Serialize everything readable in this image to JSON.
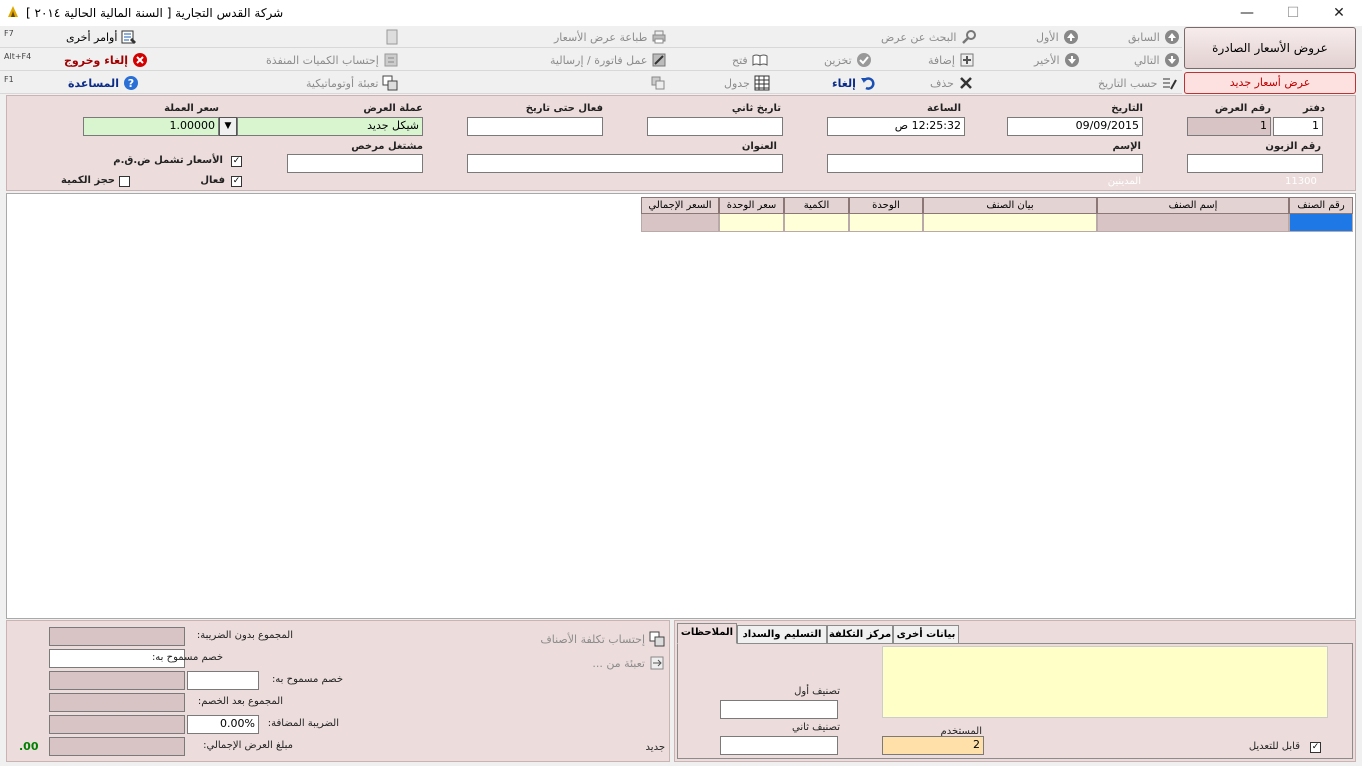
{
  "window": {
    "title": "شركة القدس التجارية  [ السنة المالية الحالية ٢٠١٤ ]",
    "minimize": "—",
    "maximize": "☐",
    "close": "✕"
  },
  "toolbar": {
    "row1": {
      "previous": "السابق",
      "first": "الأول",
      "search": "البحث عن عرض",
      "print": "طباعة عرض الأسعار",
      "other": "أوامر أخرى",
      "fkey": "F7"
    },
    "row2": {
      "next": "التالي",
      "last": "الأخير",
      "add": "إضافة",
      "save": "تخزين",
      "open": "فتح",
      "invoice": "عمل فاتورة / إرسالية",
      "calc_qty": "إحتساب الكميات المنفذة",
      "cancel_exit": "إلغاء وخروج",
      "fkey": "Alt+F4"
    },
    "row3": {
      "by_date": "حسب التاريخ",
      "delete": "حذف",
      "cancel": "إلغاء",
      "table": "جدول",
      "autofill": "تعبئة أوتوماتيكية",
      "help": "المساعدة",
      "fkey": "F1"
    },
    "issued_quotes_button": "عروض الأسعار الصادرة",
    "new_quote_button": "عرض أسعار جديد"
  },
  "header": {
    "book_label": "دفتر",
    "book_value": "1",
    "quote_no_label": "رقم العرض",
    "quote_no_value": "1",
    "date_label": "التاريخ",
    "date_value": "09/09/2015",
    "time_label": "الساعة",
    "time_value": "12:25:32 ص",
    "second_date_label": "تاريخ ثاني",
    "second_date_value": "",
    "valid_until_label": "فعال حتى تاريخ",
    "valid_until_value": "",
    "currency_label": "عملة العرض",
    "currency_value": "شيكل جديد",
    "rate_label": "سعر العملة",
    "rate_value": "1.00000",
    "customer_no_label": "رقم الزبون",
    "customer_no_value": "",
    "name_label": "الإسم",
    "name_value": "",
    "address_label": "العنوان",
    "address_value": "",
    "licensed_label": "مشتغل مرخص",
    "licensed_value": "",
    "vat_incl_label": "الأسعار تشمل ض.ق.م",
    "vat_incl_checked": "✓",
    "active_label": "فعال",
    "active_checked": "✓",
    "reserve_label": "حجز الكمية",
    "reserve_checked": "",
    "account_no": "11300",
    "account_name": "المدينين"
  },
  "grid": {
    "columns": [
      "رقم الصنف",
      "إسم الصنف",
      "بيان الصنف",
      "الوحدة",
      "الكمية",
      "سعر الوحدة",
      "السعر الإجمالي"
    ]
  },
  "totals": {
    "calc_cost": "إحتساب تكلفة الأصناف",
    "fill_from": "تعبئة من ...",
    "subtotal_label": "المجموع بدون الضريبة:",
    "subtotal_value": "",
    "discount1_label": "خصم مسموح به:",
    "discount1_value": "",
    "discount2_label": "خصم مسموح به:",
    "discount2_pct": "",
    "discount2_value": "",
    "after_discount_label": "المجموع بعد الخصم:",
    "after_discount_value": "",
    "vat_label": "الضريبة المضافة:",
    "vat_pct": "0.00%",
    "vat_value": "",
    "total_label": "مبلغ  العرض الإجمالي:",
    "total_value": "",
    "total_side": ".00",
    "status": "جديد"
  },
  "tabs": {
    "items": [
      "بيانات أخرى",
      "مركز التكلفة",
      "التسليم والسداد",
      "الملاحظات"
    ],
    "active": "الملاحظات",
    "notes_value": "",
    "class1_label": "تصنيف أول",
    "class1_value": "",
    "class2_label": "تصنيف ثاني",
    "class2_value": "",
    "user_label": "المستخدم",
    "user_value": "2",
    "editable_label": "قابل للتعديل",
    "editable_checked": "✓"
  }
}
